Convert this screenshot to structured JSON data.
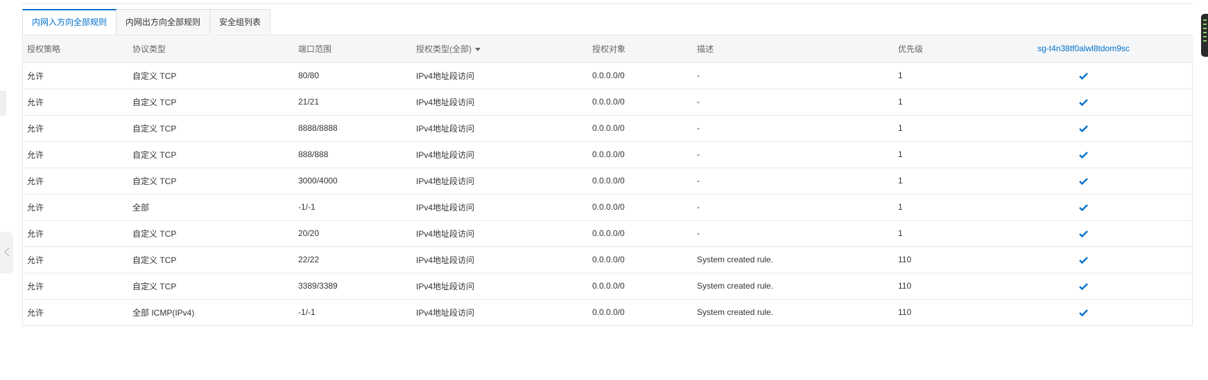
{
  "tabs": [
    {
      "label": "内网入方向全部规则",
      "active": true
    },
    {
      "label": "内网出方向全部规则",
      "active": false
    },
    {
      "label": "安全组列表",
      "active": false
    }
  ],
  "table": {
    "headers": {
      "policy": "授权策略",
      "protocol": "协议类型",
      "port_range": "端口范围",
      "auth_type": "授权类型(全部)",
      "auth_object": "授权对象",
      "description": "描述",
      "priority": "优先级",
      "security_group": "sg-t4n38tf0alwl8tdom9sc"
    },
    "rows": [
      {
        "policy": "允许",
        "protocol": "自定义 TCP",
        "port_range": "80/80",
        "auth_type": "IPv4地址段访问",
        "auth_object": "0.0.0.0/0",
        "description": "-",
        "priority": "1",
        "applied": true
      },
      {
        "policy": "允许",
        "protocol": "自定义 TCP",
        "port_range": "21/21",
        "auth_type": "IPv4地址段访问",
        "auth_object": "0.0.0.0/0",
        "description": "-",
        "priority": "1",
        "applied": true
      },
      {
        "policy": "允许",
        "protocol": "自定义 TCP",
        "port_range": "8888/8888",
        "auth_type": "IPv4地址段访问",
        "auth_object": "0.0.0.0/0",
        "description": "-",
        "priority": "1",
        "applied": true
      },
      {
        "policy": "允许",
        "protocol": "自定义 TCP",
        "port_range": "888/888",
        "auth_type": "IPv4地址段访问",
        "auth_object": "0.0.0.0/0",
        "description": "-",
        "priority": "1",
        "applied": true
      },
      {
        "policy": "允许",
        "protocol": "自定义 TCP",
        "port_range": "3000/4000",
        "auth_type": "IPv4地址段访问",
        "auth_object": "0.0.0.0/0",
        "description": "-",
        "priority": "1",
        "applied": true
      },
      {
        "policy": "允许",
        "protocol": "全部",
        "port_range": "-1/-1",
        "auth_type": "IPv4地址段访问",
        "auth_object": "0.0.0.0/0",
        "description": "-",
        "priority": "1",
        "applied": true
      },
      {
        "policy": "允许",
        "protocol": "自定义 TCP",
        "port_range": "20/20",
        "auth_type": "IPv4地址段访问",
        "auth_object": "0.0.0.0/0",
        "description": "-",
        "priority": "1",
        "applied": true
      },
      {
        "policy": "允许",
        "protocol": "自定义 TCP",
        "port_range": "22/22",
        "auth_type": "IPv4地址段访问",
        "auth_object": "0.0.0.0/0",
        "description": "System created rule.",
        "priority": "110",
        "applied": true
      },
      {
        "policy": "允许",
        "protocol": "自定义 TCP",
        "port_range": "3389/3389",
        "auth_type": "IPv4地址段访问",
        "auth_object": "0.0.0.0/0",
        "description": "System created rule.",
        "priority": "110",
        "applied": true
      },
      {
        "policy": "允许",
        "protocol": "全部 ICMP(IPv4)",
        "port_range": "-1/-1",
        "auth_type": "IPv4地址段访问",
        "auth_object": "0.0.0.0/0",
        "description": "System created rule.",
        "priority": "110",
        "applied": true
      }
    ]
  },
  "icons": {
    "check": "check-icon",
    "sort": "caret-down-icon",
    "collapse": "chevron-left-icon"
  },
  "colors": {
    "accent": "#0070cc",
    "header_bg": "#f5f6f7",
    "border": "#e5e5e5"
  }
}
